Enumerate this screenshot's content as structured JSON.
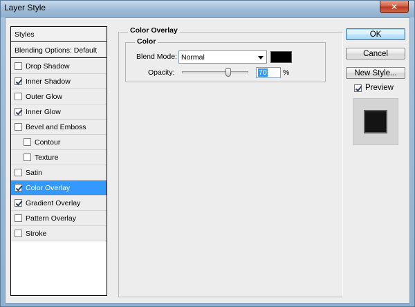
{
  "window": {
    "title": "Layer Style",
    "close_glyph": "✕"
  },
  "styles_list": {
    "header": "Styles",
    "blending": "Blending Options: Default",
    "items": [
      {
        "label": "Drop Shadow",
        "checked": false,
        "indent": false,
        "selected": false
      },
      {
        "label": "Inner Shadow",
        "checked": true,
        "indent": false,
        "selected": false
      },
      {
        "label": "Outer Glow",
        "checked": false,
        "indent": false,
        "selected": false
      },
      {
        "label": "Inner Glow",
        "checked": true,
        "indent": false,
        "selected": false
      },
      {
        "label": "Bevel and Emboss",
        "checked": false,
        "indent": false,
        "selected": false
      },
      {
        "label": "Contour",
        "checked": false,
        "indent": true,
        "selected": false
      },
      {
        "label": "Texture",
        "checked": false,
        "indent": true,
        "selected": false
      },
      {
        "label": "Satin",
        "checked": false,
        "indent": false,
        "selected": false
      },
      {
        "label": "Color Overlay",
        "checked": true,
        "indent": false,
        "selected": true
      },
      {
        "label": "Gradient Overlay",
        "checked": true,
        "indent": false,
        "selected": false
      },
      {
        "label": "Pattern Overlay",
        "checked": false,
        "indent": false,
        "selected": false
      },
      {
        "label": "Stroke",
        "checked": false,
        "indent": false,
        "selected": false
      }
    ]
  },
  "panel": {
    "title": "Color Overlay",
    "group_title": "Color",
    "blend_mode_label": "Blend Mode:",
    "blend_mode_value": "Normal",
    "overlay_color": "#000000",
    "opacity_label": "Opacity:",
    "opacity_value": "70",
    "opacity_unit": "%"
  },
  "buttons": {
    "ok": "OK",
    "cancel": "Cancel",
    "new_style": "New Style...",
    "preview_label": "Preview",
    "preview_checked": true
  }
}
